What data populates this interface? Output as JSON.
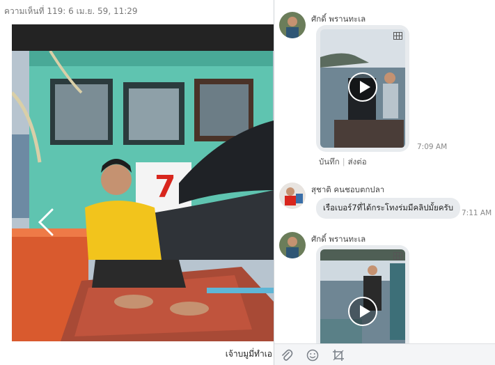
{
  "photo_view": {
    "comment_meta": "ความเห็นที่ 119: 6 เม.ย. 59, 11:29",
    "caption": "เจ้าบมูมี่ทำเอ",
    "prev_icon": "chevron-left-icon",
    "boat_sign": "7",
    "colors": {
      "hull": "#5fc4b0",
      "shirt": "#f2c41c",
      "deck": "#c0543d"
    }
  },
  "chat": {
    "messages": [
      {
        "sender": "ศักดิ์ พรานทะเล",
        "type": "video",
        "time": "7:09 AM",
        "actions": [
          "บันทึก",
          "ส่งต่อ"
        ]
      },
      {
        "sender": "สุชาติ คนชอบตกปลา",
        "type": "text",
        "text": "เรือเบอร์7ที่ได้กระโทงร่มมีคลิปมั้ยครับ",
        "time": "7:11 AM"
      },
      {
        "sender": "ศักดิ์ พรานทะเล",
        "type": "video"
      }
    ],
    "input_bar": {
      "icons": [
        "paperclip-icon",
        "smiley-icon",
        "crop-icon"
      ]
    },
    "colors": {
      "bubble": "#e8ebee"
    }
  }
}
